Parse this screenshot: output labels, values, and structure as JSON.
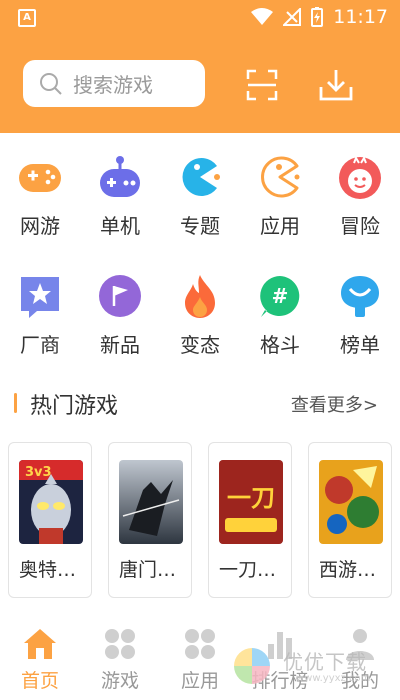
{
  "status_bar": {
    "app_glyph": "A",
    "time": "11:17"
  },
  "search": {
    "placeholder": "搜索游戏"
  },
  "categories": [
    {
      "label": "网游",
      "icon": "gamepad-icon"
    },
    {
      "label": "单机",
      "icon": "controller-icon"
    },
    {
      "label": "专题",
      "icon": "pacman-blue-icon"
    },
    {
      "label": "应用",
      "icon": "pacman-outline-icon"
    },
    {
      "label": "冒险",
      "icon": "mascot-icon"
    },
    {
      "label": "厂商",
      "icon": "star-badge-icon"
    },
    {
      "label": "新品",
      "icon": "flag-icon"
    },
    {
      "label": "变态",
      "icon": "flame-icon"
    },
    {
      "label": "格斗",
      "icon": "hashtag-icon"
    },
    {
      "label": "榜单",
      "icon": "rank-icon"
    }
  ],
  "hot_section": {
    "title": "热门游戏",
    "more": "查看更多>"
  },
  "hot_games": [
    {
      "name": "奥特…",
      "thumb_label": "3v3"
    },
    {
      "name": "唐门…"
    },
    {
      "name": "一刀…",
      "thumb_label": "一刀"
    },
    {
      "name": "西游…"
    }
  ],
  "bottom_nav": [
    {
      "label": "首页",
      "icon": "home-icon",
      "active": true
    },
    {
      "label": "游戏",
      "icon": "grid-icon",
      "active": false
    },
    {
      "label": "应用",
      "icon": "apps-icon",
      "active": false
    },
    {
      "label": "排行榜",
      "icon": "chart-icon",
      "active": false
    },
    {
      "label": "我的",
      "icon": "user-icon",
      "active": false
    }
  ],
  "watermark": {
    "text": "优优下载",
    "url": "www.yyxz.com"
  },
  "colors": {
    "accent": "#fca243",
    "inactive": "#999999"
  }
}
